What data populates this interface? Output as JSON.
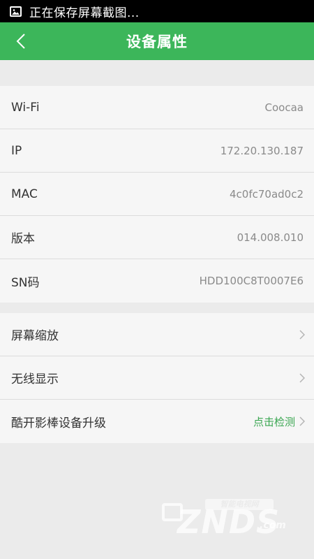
{
  "status_bar": {
    "icon": "image-icon",
    "notification_text": "正在保存屏幕截图..."
  },
  "header": {
    "back_icon": "chevron-left-icon",
    "title": "设备属性",
    "background_color": "#3cb65a"
  },
  "device_info": [
    {
      "label": "Wi-Fi",
      "value": "Coocaa"
    },
    {
      "label": "IP",
      "value": "172.20.130.187"
    },
    {
      "label": "MAC",
      "value": "4c0fc70ad0c2"
    },
    {
      "label": "版本",
      "value": "014.008.010"
    },
    {
      "label": "SN码",
      "value": "HDD100C8T0007E6"
    }
  ],
  "settings": [
    {
      "label": "屏幕缩放",
      "icon": "chevron-right-icon"
    },
    {
      "label": "无线显示",
      "icon": "chevron-right-icon"
    },
    {
      "label": "酷开影棒设备升级",
      "action": "点击检测",
      "action_color": "#3aa651",
      "icon": "chevron-right-icon"
    }
  ],
  "watermark": {
    "brand": "ZNDS",
    "suffix": ".com",
    "banner": "智能电视网"
  }
}
